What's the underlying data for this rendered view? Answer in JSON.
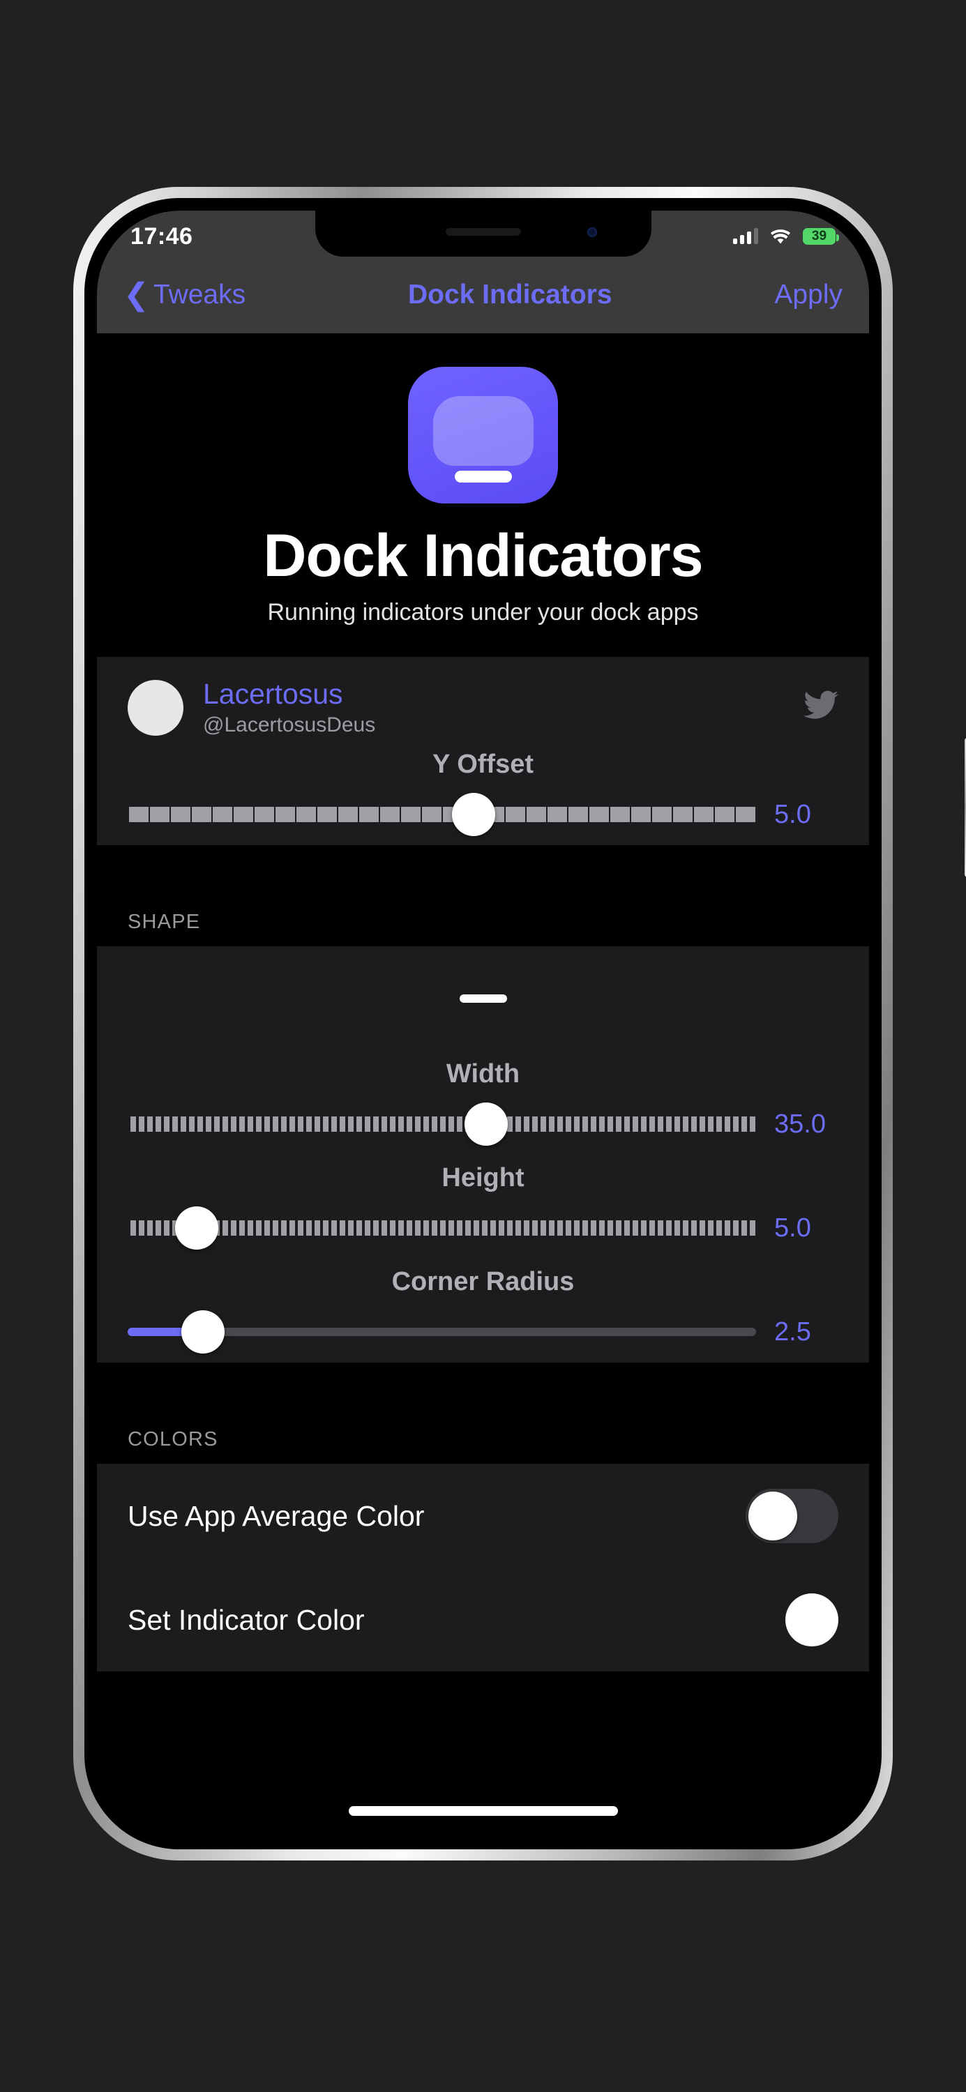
{
  "status_bar": {
    "time": "17:46",
    "signal_icon": "cellular-signal-icon",
    "signal_bars_filled": 3,
    "signal_bars_total": 4,
    "wifi_icon": "wifi-icon",
    "battery_percent": "39",
    "battery_color": "#53d769"
  },
  "nav_bar": {
    "back_label": "Tweaks",
    "back_icon": "chevron-left-icon",
    "title": "Dock Indicators",
    "apply_label": "Apply",
    "accent_color": "#6c6cf5"
  },
  "header": {
    "icon_name": "dock-indicators-app-icon",
    "title": "Dock Indicators",
    "subtitle": "Running indicators under your dock apps",
    "icon_color": "#5b4cf5"
  },
  "credits": {
    "avatar_name": "developer-avatar",
    "name": "Lacertosus",
    "handle": "@LacertosusDeus",
    "social_icon": "twitter-icon"
  },
  "sliders": {
    "y_offset": {
      "label": "Y Offset",
      "value": "5.0",
      "position_pct": 55,
      "track_style": "coarse-ticks"
    },
    "width": {
      "label": "Width",
      "value": "35.0",
      "position_pct": 57,
      "track_style": "fine-ticks"
    },
    "height": {
      "label": "Height",
      "value": "5.0",
      "position_pct": 11,
      "track_style": "fine-ticks"
    },
    "corner_radius": {
      "label": "Corner Radius",
      "value": "2.5",
      "position_pct": 12,
      "track_style": "plain-filled"
    }
  },
  "sections": {
    "shape": {
      "header": "SHAPE",
      "preview_name": "indicator-shape-preview"
    },
    "colors": {
      "header": "COLORS"
    }
  },
  "colors_settings": {
    "use_app_average_color": {
      "label": "Use App Average Color",
      "toggle_on": false
    },
    "set_indicator_color": {
      "label": "Set Indicator Color",
      "swatch_color": "#ffffff"
    }
  },
  "home_indicator": {
    "name": "home-indicator"
  }
}
